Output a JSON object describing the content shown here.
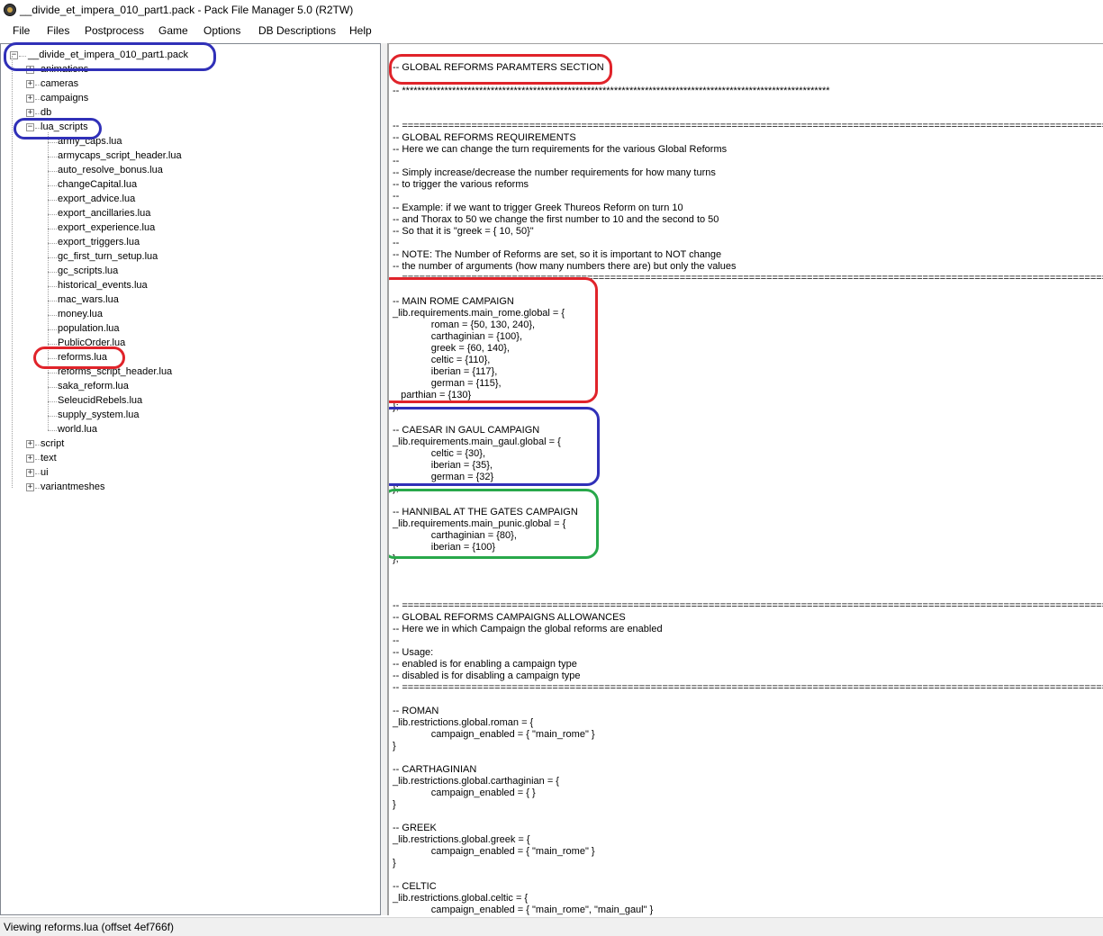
{
  "window": {
    "title": "__divide_et_impera_010_part1.pack - Pack File Manager 5.0 (R2TW)"
  },
  "menu": [
    "File",
    "Files",
    "Postprocess",
    "Game",
    "Options",
    "DB Descriptions",
    "Help"
  ],
  "tree": {
    "root": "__divide_et_impera_010_part1.pack",
    "folders_top": [
      "animations",
      "cameras",
      "campaigns",
      "db"
    ],
    "lua_folder": "lua_scripts",
    "lua_files": [
      "army_caps.lua",
      "armycaps_script_header.lua",
      "auto_resolve_bonus.lua",
      "changeCapital.lua",
      "export_advice.lua",
      "export_ancillaries.lua",
      "export_experience.lua",
      "export_triggers.lua",
      "gc_first_turn_setup.lua",
      "gc_scripts.lua",
      "historical_events.lua",
      "mac_wars.lua",
      "money.lua",
      "population.lua",
      "PublicOrder.lua",
      "reforms.lua",
      "reforms_script_header.lua",
      "saka_reform.lua",
      "SeleucidRebels.lua",
      "supply_system.lua",
      "world.lua"
    ],
    "selected_file": "reforms.lua",
    "folders_bottom": [
      "script",
      "text",
      "ui",
      "variantmeshes"
    ]
  },
  "editor": {
    "lines": [
      "-- GLOBAL REFORMS PARAMTERS SECTION",
      "",
      "-- ***************************************************************************************************************",
      "",
      "",
      "-- =================================================================================================================================",
      "-- GLOBAL REFORMS REQUIREMENTS",
      "-- Here we can change the turn requirements for the various Global Reforms",
      "--",
      "-- Simply increase/decrease the number requirements for how many turns",
      "-- to trigger the various reforms",
      "--",
      "-- Example: if we want to trigger Greek Thureos Reform on turn 10",
      "-- and Thorax to 50 we change the first number to 10 and the second to 50",
      "-- So that it is \"greek = { 10, 50}\"",
      "--",
      "-- NOTE: The Number of Reforms are set, so it is important to NOT change",
      "-- the number of arguments (how many numbers there are) but only the values",
      "-- =================================================================================================================================",
      "",
      "-- MAIN ROME CAMPAIGN",
      "_lib.requirements.main_rome.global = {",
      "              roman = {50, 130, 240},",
      "              carthaginian = {100},",
      "              greek = {60, 140},",
      "              celtic = {110},",
      "              iberian = {117},",
      "              german = {115},",
      "   parthian = {130}",
      "};",
      "",
      "-- CAESAR IN GAUL CAMPAIGN",
      "_lib.requirements.main_gaul.global = {",
      "              celtic = {30},",
      "              iberian = {35},",
      "              german = {32}",
      "};",
      "",
      "-- HANNIBAL AT THE GATES CAMPAIGN",
      "_lib.requirements.main_punic.global = {",
      "              carthaginian = {80},",
      "              iberian = {100}",
      "};",
      "",
      "",
      "",
      "-- =================================================================================================================================",
      "-- GLOBAL REFORMS CAMPAIGNS ALLOWANCES",
      "-- Here we in which Campaign the global reforms are enabled",
      "--",
      "-- Usage:",
      "-- enabled is for enabling a campaign type",
      "-- disabled is for disabling a campaign type",
      "-- =================================================================================================================================",
      "",
      "-- ROMAN",
      "_lib.restrictions.global.roman = {",
      "              campaign_enabled = { \"main_rome\" }",
      "}",
      "",
      "-- CARTHAGINIAN",
      "_lib.restrictions.global.carthaginian = {",
      "              campaign_enabled = { }",
      "}",
      "",
      "-- GREEK",
      "_lib.restrictions.global.greek = {",
      "              campaign_enabled = { \"main_rome\" }",
      "}",
      "",
      "-- CELTIC",
      "_lib.restrictions.global.celtic = {",
      "              campaign_enabled = { \"main_rome\", \"main_gaul\" }",
      "}"
    ]
  },
  "status": {
    "text": "Viewing reforms.lua (offset 4ef766f)"
  },
  "colors": {
    "highlight_red": "#e0232a",
    "highlight_blue": "#3030b8",
    "highlight_green": "#28a84a"
  }
}
